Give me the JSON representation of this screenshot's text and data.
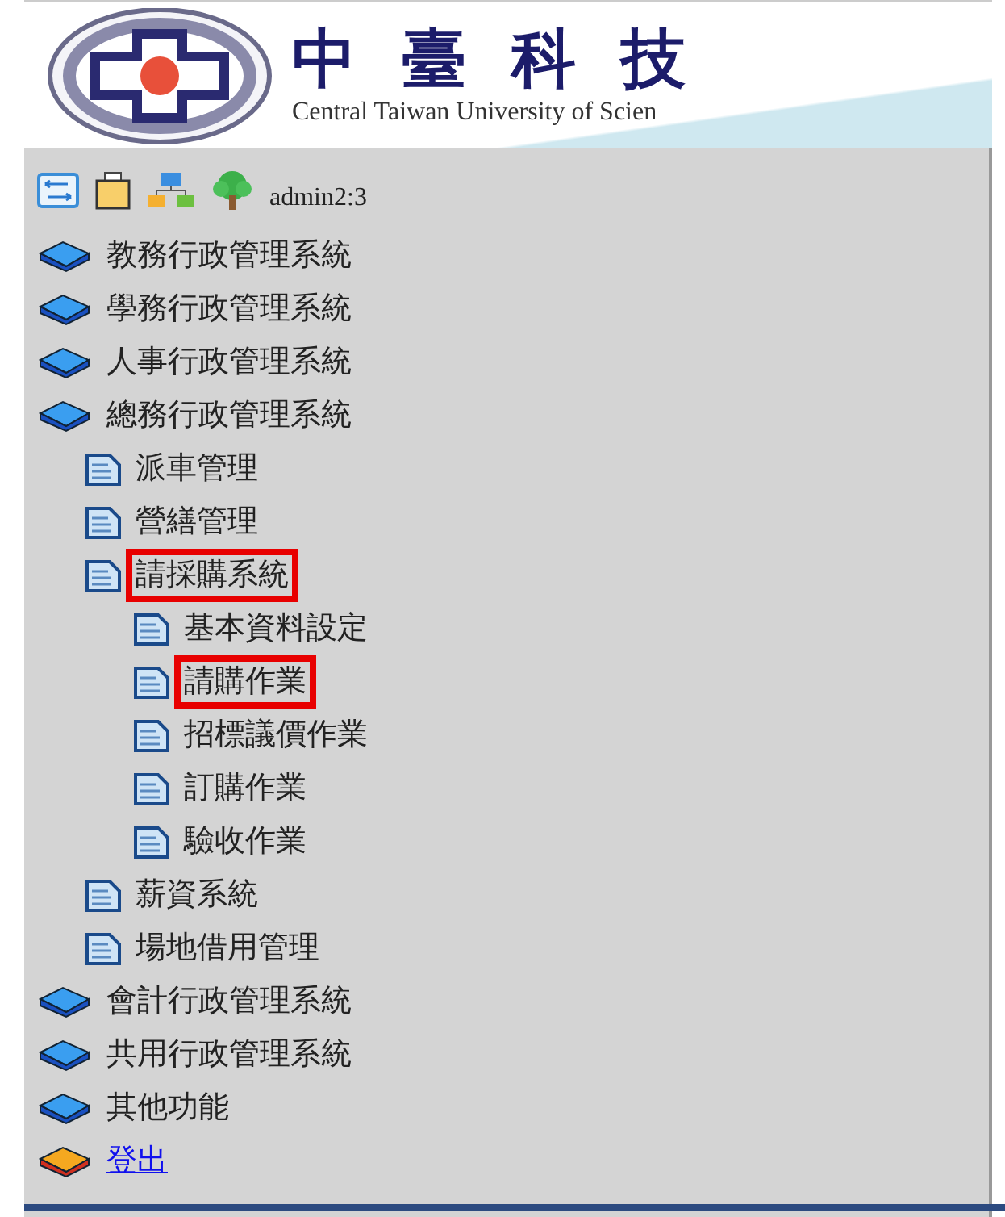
{
  "header": {
    "title": "中臺科技",
    "subtitle": "Central Taiwan University of Scien"
  },
  "toolbar": {
    "user": "admin2:3"
  },
  "menu": [
    {
      "label": "教務行政管理系統",
      "kind": "book",
      "highlighted": false
    },
    {
      "label": "學務行政管理系統",
      "kind": "book",
      "highlighted": false
    },
    {
      "label": "人事行政管理系統",
      "kind": "book",
      "highlighted": false
    },
    {
      "label": "總務行政管理系統",
      "kind": "book",
      "highlighted": false,
      "children": [
        {
          "label": "派車管理",
          "kind": "page",
          "highlighted": false
        },
        {
          "label": "營繕管理",
          "kind": "page",
          "highlighted": false
        },
        {
          "label": "請採購系統",
          "kind": "page",
          "highlighted": true,
          "children": [
            {
              "label": "基本資料設定",
              "kind": "page",
              "highlighted": false
            },
            {
              "label": "請購作業",
              "kind": "page",
              "highlighted": true
            },
            {
              "label": "招標議價作業",
              "kind": "page",
              "highlighted": false
            },
            {
              "label": "訂購作業",
              "kind": "page",
              "highlighted": false
            },
            {
              "label": "驗收作業",
              "kind": "page",
              "highlighted": false
            }
          ]
        },
        {
          "label": "薪資系統",
          "kind": "page",
          "highlighted": false
        },
        {
          "label": "場地借用管理",
          "kind": "page",
          "highlighted": false
        }
      ]
    },
    {
      "label": "會計行政管理系統",
      "kind": "book",
      "highlighted": false
    },
    {
      "label": "共用行政管理系統",
      "kind": "book",
      "highlighted": false
    },
    {
      "label": "其他功能",
      "kind": "book",
      "highlighted": false
    },
    {
      "label": "登出",
      "kind": "logout",
      "highlighted": false
    }
  ]
}
